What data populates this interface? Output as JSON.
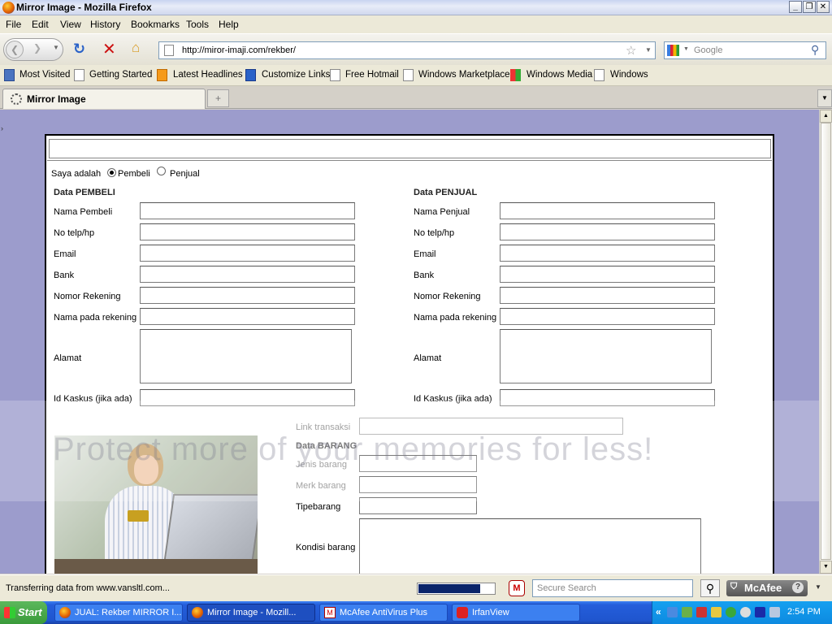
{
  "window": {
    "title": "Mirror Image - Mozilla Firefox"
  },
  "menu": [
    "File",
    "Edit",
    "View",
    "History",
    "Bookmarks",
    "Tools",
    "Help"
  ],
  "nav": {
    "url": "http://miror-imaji.com/rekber/",
    "search_placeholder": "Google"
  },
  "bookmarks": [
    "Most Visited",
    "Getting Started",
    "Latest Headlines",
    "Customize Links",
    "Free Hotmail",
    "Windows Marketplace",
    "Windows Media",
    "Windows"
  ],
  "tab": {
    "label": "Mirror Image",
    "new_tab": "+"
  },
  "form": {
    "role_prompt": "Saya adalah",
    "role_options": [
      "Pembeli",
      "Penjual"
    ],
    "role_selected": "Pembeli",
    "buyer": {
      "heading": "Data PEMBELI",
      "fields": [
        "Nama Pembeli",
        "No telp/hp",
        "Email",
        "Bank",
        "Nomor Rekening",
        "Nama pada rekening",
        "Alamat",
        "Id Kaskus (jika ada)"
      ]
    },
    "seller": {
      "heading": "Data PENJUAL",
      "fields": [
        "Nama Penjual",
        "No telp/hp",
        "Email",
        "Bank",
        "Nomor Rekening",
        "Nama pada rekening",
        "Alamat",
        "Id Kaskus (jika ada)"
      ]
    },
    "link_label": "Link transaksi",
    "goods": {
      "heading": "Data BARANG",
      "fields": [
        "Jenis barang",
        "Merk barang",
        "Tipebarang",
        "Kondisi barang"
      ]
    }
  },
  "watermark_text": "Protect more of your memories for less!",
  "statusbar": {
    "text": "Transferring data from www.vansltl.com...",
    "progress": 0.82,
    "secure_search_placeholder": "Secure Search",
    "mcafee": "McAfee"
  },
  "taskbar": {
    "start": "Start",
    "tasks": [
      "JUAL: Rekber MIRROR I...",
      "Mirror Image - Mozill...",
      "McAfee AntiVirus Plus",
      "IrfanView"
    ],
    "active_task": "Mirror Image - Mozill...",
    "clock": "2:54 PM"
  },
  "colors": {
    "page_bg": "#9c9ccc",
    "taskbar": "#245edb",
    "progress_fill": "#0a246a"
  }
}
